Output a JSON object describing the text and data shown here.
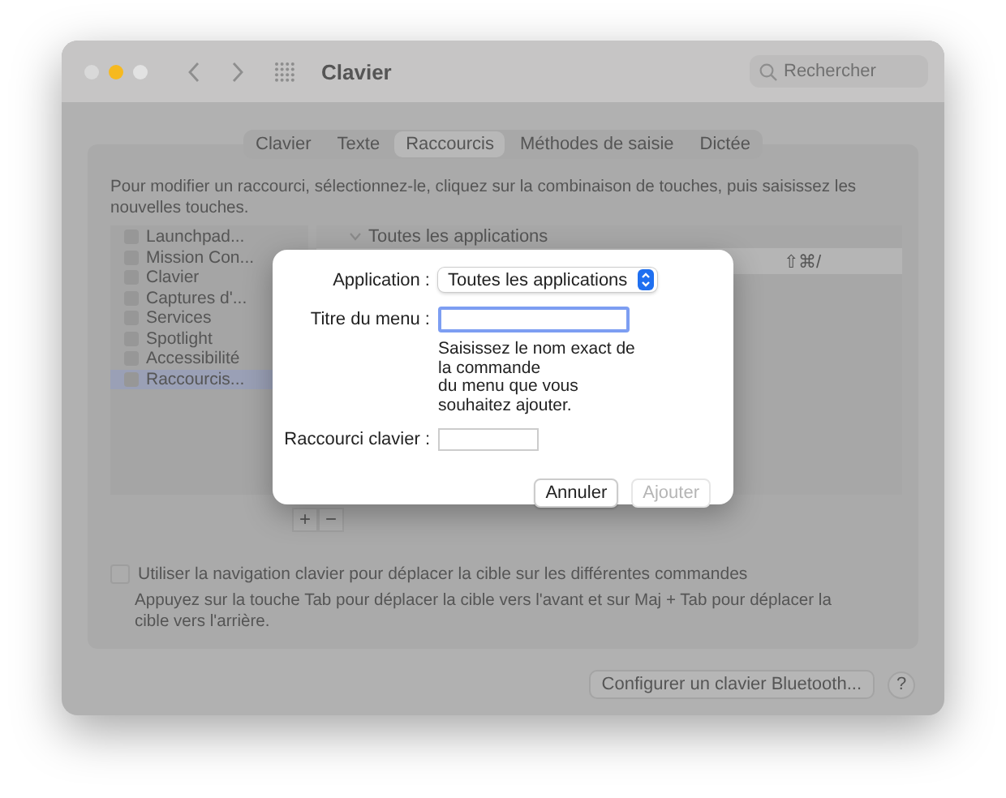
{
  "window": {
    "title": "Clavier",
    "search_placeholder": "Rechercher"
  },
  "tabs": [
    {
      "label": "Clavier",
      "selected": false
    },
    {
      "label": "Texte",
      "selected": false
    },
    {
      "label": "Raccourcis",
      "selected": true
    },
    {
      "label": "Méthodes de saisie",
      "selected": false
    },
    {
      "label": "Dictée",
      "selected": false
    }
  ],
  "description": "Pour modifier un raccourci, sélectionnez-le, cliquez sur la combinaison de touches, puis saisissez les nouvelles touches.",
  "sidebar": {
    "items": [
      {
        "label": "Launchpad...",
        "selected": false
      },
      {
        "label": "Mission Con...",
        "selected": false
      },
      {
        "label": "Clavier",
        "selected": false
      },
      {
        "label": "Captures d'...",
        "selected": false
      },
      {
        "label": "Services",
        "selected": false
      },
      {
        "label": "Spotlight",
        "selected": false
      },
      {
        "label": "Accessibilité",
        "selected": false
      },
      {
        "label": "Raccourcis...",
        "selected": true
      }
    ]
  },
  "shortcuts": {
    "group": "Toutes les applications",
    "expanded": true,
    "rows": [
      {
        "shortcut": "⇧⌘/"
      }
    ]
  },
  "list_buttons": [
    "+",
    "−"
  ],
  "keyboard_navigation": {
    "label": "Utiliser la navigation clavier pour déplacer la cible sur les différentes commandes",
    "checked": false,
    "hint": "Appuyez sur la touche Tab pour déplacer la cible vers l'avant et sur Maj + Tab pour déplacer la cible vers l'arrière."
  },
  "bluetooth_button": "Configurer un clavier Bluetooth...",
  "help_button": "?",
  "dialog": {
    "fields": [
      {
        "kind": "popup",
        "label": "Application :",
        "value": "Toutes les applications"
      },
      {
        "kind": "text",
        "label": "Titre du menu :",
        "focused": true,
        "hint": "Saisissez le nom exact de\nla commande\ndu menu que vous\nsouhaitez ajouter."
      },
      {
        "kind": "shortcut",
        "label": "Raccourci clavier :"
      }
    ],
    "buttons": [
      {
        "label": "Annuler",
        "disabled": false
      },
      {
        "label": "Ajouter",
        "disabled": true
      }
    ]
  }
}
